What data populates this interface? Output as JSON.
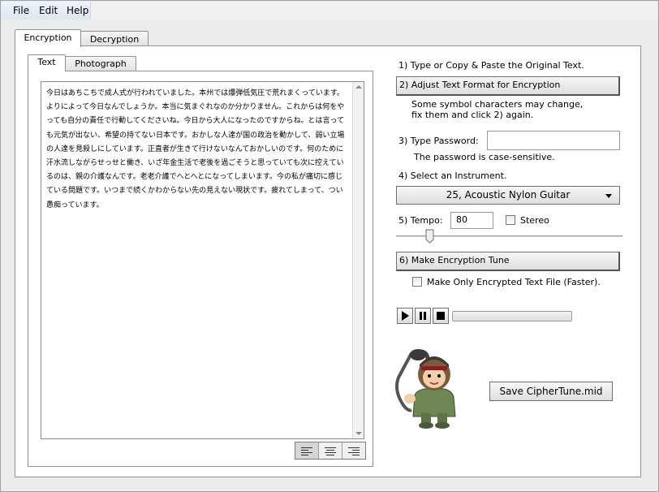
{
  "menu": {
    "file": "File",
    "edit": "Edit",
    "help": "Help"
  },
  "main_tabs": {
    "encryption": "Encryption",
    "decryption": "Decryption"
  },
  "sub_tabs": {
    "text": "Text",
    "photograph": "Photograph"
  },
  "text_area": {
    "content": "今日はあちこちで成人式が行われていました。本州では爆弾低気圧で荒れまくっています。よりによって今日なんでしょうか。本当に気まぐれなのか分かりません。これからは何をやっても自分の責任で行動してくださいね。今日から大人になったのですからね。とは言っても元気が出ない、希望の持てない日本です。おかしな人達が国の政治を動かして、弱い立場の人達を見殺しにしています。正直者が生きて行けないなんておかしいのです。何のために汗水流しながらせっせと働き、いざ年金生活で老後を過ごそうと思っていても次に控えているのは、親の介護なんです。老老介護でへとへとになってしまいます。今の私が痛切に感じている問題です。いつまで続くかわからない先の見えない現状です。疲れてしまって、つい愚痴っています。",
    "progress_fraction": 0.0
  },
  "steps": {
    "step1": "1) Type or Copy & Paste the Original Text.",
    "step2_button": "2) Adjust Text Format for Encryption",
    "step2_note_line1": "Some symbol characters may change,",
    "step2_note_line2": "fix them and click 2) again.",
    "step3_label": "3) Type Password:",
    "password_value": "",
    "step3_note": "The password is case-sensitive.",
    "step4_label": "4) Select an Instrument.",
    "instrument_selected": "25, Acoustic Nylon Guitar",
    "step5_label": "5) Tempo:",
    "tempo_value": "80",
    "stereo_label": "Stereo",
    "stereo_checked": false,
    "step6_button": "6) Make Encryption Tune",
    "only_text_label": "Make Only Encrypted Text File (Faster).",
    "only_text_checked": false
  },
  "player": {
    "progress_fraction": 0.0
  },
  "save_button": "Save CipherTune.mid",
  "icons": {
    "text_alignment": [
      "align-left-icon",
      "align-center-icon",
      "align-right-icon"
    ],
    "player": [
      "play-icon",
      "pause-icon",
      "stop-icon"
    ],
    "mascot": "guitar-mascot-icon",
    "dropdown": "dropdown-arrow-icon"
  },
  "colors": {
    "window_bg": "#ececec",
    "panel_bg": "#ffffff",
    "button_face": "#e4e4e4"
  }
}
